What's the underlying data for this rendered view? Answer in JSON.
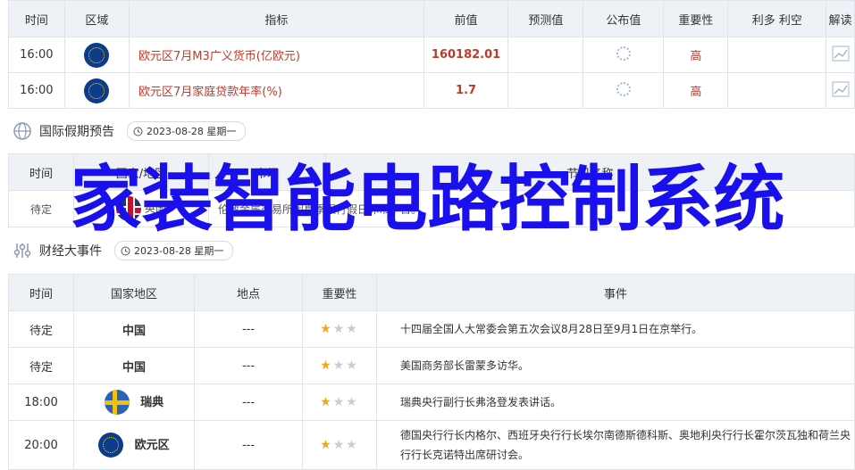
{
  "econ": {
    "headers": [
      "时间",
      "区域",
      "指标",
      "前值",
      "预测值",
      "公布值",
      "重要性",
      "利多 利空",
      "解读"
    ],
    "rows": [
      {
        "time": "16:00",
        "flag": "eu-flag",
        "indicator": "欧元区7月M3广义货币(亿欧元)",
        "previous": "160182.01",
        "forecast": "",
        "actual_icon": "loading-icon",
        "importance": "高",
        "interpret_icon": "chart-icon"
      },
      {
        "time": "16:00",
        "flag": "eu-flag",
        "indicator": "欧元区7月家庭贷款年率(%)",
        "previous": "1.7",
        "forecast": "",
        "actual_icon": "loading-icon",
        "importance": "高",
        "interpret_icon": "chart-icon"
      }
    ]
  },
  "holiday": {
    "title": "国际假期预告",
    "date": "2023-08-28 星期一",
    "headers": [
      "时间",
      "国家/地区",
      "市场",
      "节日名称"
    ],
    "row": {
      "time": "待定",
      "flag": "uk-flag",
      "region": "英国",
      "text": "伦敦金属交易所因夏季银行假日休市一日。"
    }
  },
  "events": {
    "title": "财经大事件",
    "date": "2023-08-28 星期一",
    "headers": [
      "时间",
      "国家地区",
      "地点",
      "重要性",
      "事件"
    ],
    "rows": [
      {
        "time": "待定",
        "region": "中国",
        "flag": "",
        "location": "---",
        "stars": 1,
        "event": "十四届全国人大常委会第五次会议8月28日至9月1日在京举行。"
      },
      {
        "time": "待定",
        "region": "中国",
        "flag": "",
        "location": "---",
        "stars": 1,
        "event": "美国商务部长雷蒙多访华。"
      },
      {
        "time": "18:00",
        "region": "瑞典",
        "flag": "se-flag",
        "location": "---",
        "stars": 1,
        "event": "瑞典央行副行长弗洛登发表讲话。"
      },
      {
        "time": "20:00",
        "region": "欧元区",
        "flag": "eu-flag",
        "location": "---",
        "stars": 1,
        "event": "德国央行行长内格尔、西班牙央行行长埃尔南德斯德科斯、奥地利央行行长霍尔茨瓦独和荷兰央行行长克诺特出席研讨会。"
      }
    ]
  },
  "overlay": {
    "text": "家装智能电路控制系统"
  },
  "colors": {
    "accent_red": "#c0392b",
    "overlay_blue": "#1a10ee",
    "star": "#f0a818"
  }
}
